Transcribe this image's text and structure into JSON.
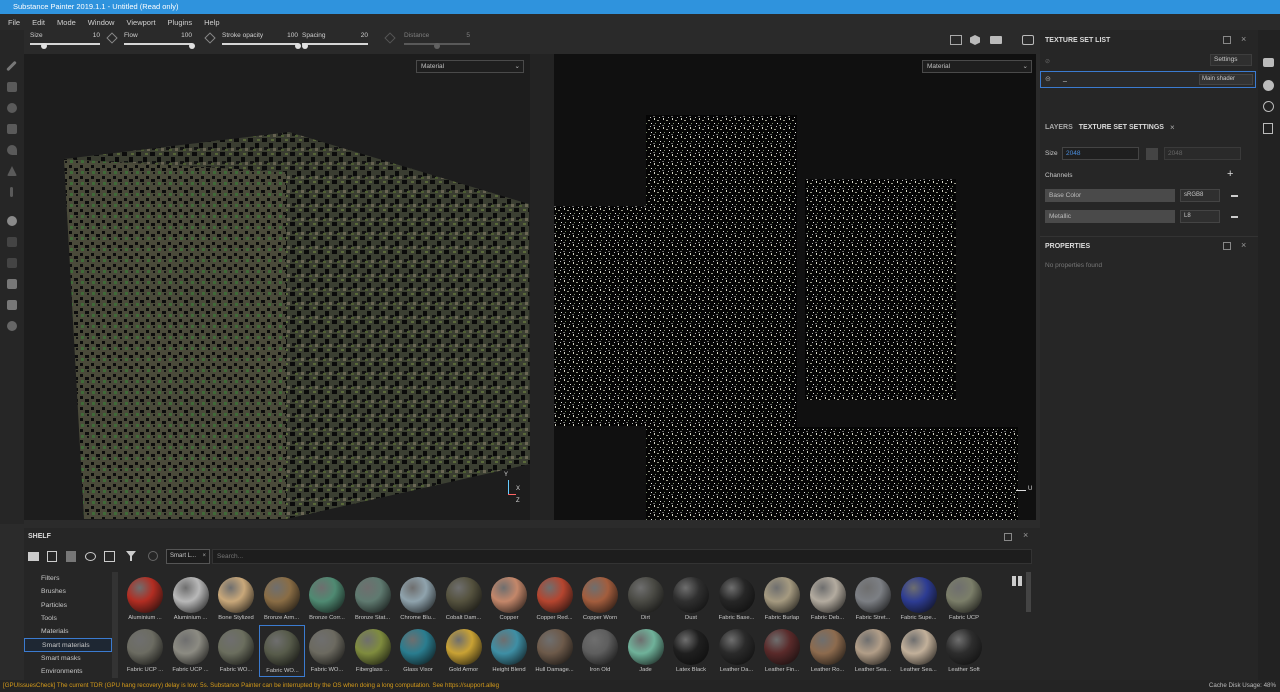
{
  "window": {
    "title": "Substance Painter 2019.1.1 - Untitled (Read only)"
  },
  "menu": [
    "File",
    "Edit",
    "Mode",
    "Window",
    "Viewport",
    "Plugins",
    "Help"
  ],
  "toolbar": {
    "size_label": "Size",
    "size_value": "10",
    "size_fill": 0.2,
    "flow_label": "Flow",
    "flow_value": "100",
    "flow_fill": 1.0,
    "stroke_label": "Stroke opacity",
    "stroke_value": "100",
    "stroke_fill": 1.0,
    "spacing_label": "Spacing",
    "spacing_value": "20",
    "spacing_fill": 0.05,
    "distance_label": "Distance",
    "distance_value": "5",
    "distance_fill": 0.5
  },
  "viewport": {
    "left_mode": "Material",
    "right_mode": "Material",
    "axis_y": "Y",
    "axis_x": "X",
    "axis_z": "Z",
    "axis_u": "U"
  },
  "texture_set_list": {
    "title": "TEXTURE SET LIST",
    "settings_label": "Settings",
    "item_name": "_",
    "shader_label": "Main shader"
  },
  "tss": {
    "tab_layers": "LAYERS",
    "tab_settings": "TEXTURE SET SETTINGS",
    "size_label": "Size",
    "size_value": "2048",
    "size_value2": "2048",
    "channels_label": "Channels",
    "channels": [
      {
        "name": "Base Color",
        "format": "sRGB8"
      },
      {
        "name": "Metallic",
        "format": "L8"
      }
    ]
  },
  "properties": {
    "title": "PROPERTIES",
    "empty_text": "No properties found"
  },
  "shelf": {
    "title": "SHELF",
    "filter_tag": "Smart L...",
    "search_placeholder": "Search...",
    "categories": [
      "Filters",
      "Brushes",
      "Particles",
      "Tools",
      "Materials",
      "Smart materials",
      "Smart masks",
      "Environments"
    ],
    "selected_category": "Smart materials",
    "items": [
      {
        "label": "Aluminium ...",
        "color": "#b22d22"
      },
      {
        "label": "Aluminium ...",
        "color": "#b8b8b8"
      },
      {
        "label": "Bone Stylized",
        "color": "#c9a87a"
      },
      {
        "label": "Bronze Arm...",
        "color": "#8a6d45"
      },
      {
        "label": "Bronze Corr...",
        "color": "#4f8a72"
      },
      {
        "label": "Bronze Stat...",
        "color": "#5f7a70"
      },
      {
        "label": "Chrome Blu...",
        "color": "#8fa3ad"
      },
      {
        "label": "Cobalt Dam...",
        "color": "#55523e"
      },
      {
        "label": "Copper",
        "color": "#c4876a"
      },
      {
        "label": "Copper Red...",
        "color": "#b5452f"
      },
      {
        "label": "Copper Worn",
        "color": "#a35d3d"
      },
      {
        "label": "Dirt",
        "color": "#4a4a44"
      },
      {
        "label": "Dust",
        "color": "#2f2f2f"
      },
      {
        "label": "Fabric Base...",
        "color": "#262626"
      },
      {
        "label": "Fabric Burlap",
        "color": "#a59a80"
      },
      {
        "label": "Fabric Deb...",
        "color": "#b3ab9f"
      },
      {
        "label": "Fabric Stret...",
        "color": "#7c7f84"
      },
      {
        "label": "Fabric Supe...",
        "color": "#2d3c93"
      },
      {
        "label": "Fabric UCP",
        "color": "#7b7e69"
      },
      {
        "label": "Fabric UCP ...",
        "color": "#6c6c62"
      },
      {
        "label": "Fabric UCP ...",
        "color": "#8c8b82"
      },
      {
        "label": "Fabric WO...",
        "color": "#6b6e5e"
      },
      {
        "label": "Fabric WO...",
        "color": "#575b4a"
      },
      {
        "label": "Fabric WO...",
        "color": "#6c6a60"
      },
      {
        "label": "Fiberglass ...",
        "color": "#7f8c3e"
      },
      {
        "label": "Glass Visor",
        "color": "#2a7d8f"
      },
      {
        "label": "Gold Armor",
        "color": "#c9a234"
      },
      {
        "label": "Height Blend",
        "color": "#3e8fa5"
      },
      {
        "label": "Hull Damage...",
        "color": "#6d5a4a"
      },
      {
        "label": "Iron Old",
        "color": "#5e5e5e"
      },
      {
        "label": "Jade",
        "color": "#6fb29a"
      },
      {
        "label": "Latex Black",
        "color": "#1f1f1f"
      },
      {
        "label": "Leather Da...",
        "color": "#2a2a2a"
      },
      {
        "label": "Leather Fin...",
        "color": "#5a2a2a"
      },
      {
        "label": "Leather Ro...",
        "color": "#8d6b4e"
      },
      {
        "label": "Leather Sea...",
        "color": "#b29e88"
      },
      {
        "label": "Leather Sea...",
        "color": "#c2b09a"
      },
      {
        "label": "Leather Soft",
        "color": "#2d2d2d"
      }
    ]
  },
  "status": {
    "message": "[GPUIssuesCheck] The current TDR (GPU hang recovery) delay is low: 5s. Substance Painter can be interrupted by the OS when doing a long computation. See https://support.alleg",
    "cache_label": "Cache Disk Usage:",
    "cache_value": "48%"
  }
}
